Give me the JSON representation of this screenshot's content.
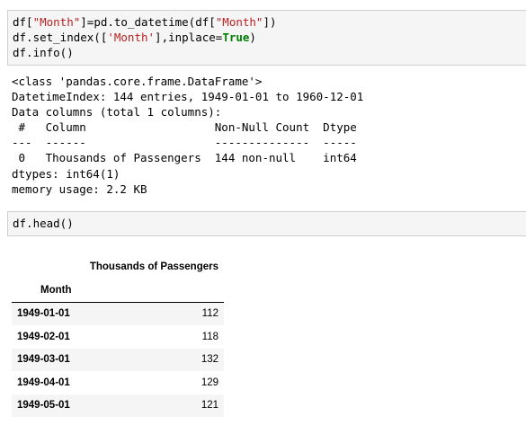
{
  "cell1": {
    "lines": [
      [
        {
          "t": "df[",
          "c": "n"
        },
        {
          "t": "\"Month\"",
          "c": "str"
        },
        {
          "t": "]=pd.to_datetime(df[",
          "c": "n"
        },
        {
          "t": "\"Month\"",
          "c": "str"
        },
        {
          "t": "])",
          "c": "n"
        }
      ],
      [
        {
          "t": "df.set_index([",
          "c": "n"
        },
        {
          "t": "'Month'",
          "c": "str"
        },
        {
          "t": "],inplace=",
          "c": "n"
        },
        {
          "t": "True",
          "c": "kw"
        },
        {
          "t": ")",
          "c": "n"
        }
      ],
      [
        {
          "t": "df.info()",
          "c": "n"
        }
      ]
    ]
  },
  "output1": {
    "lines": [
      "<class 'pandas.core.frame.DataFrame'>",
      "DatetimeIndex: 144 entries, 1949-01-01 to 1960-12-01",
      "Data columns (total 1 columns):",
      " #   Column                   Non-Null Count  Dtype",
      "---  ------                   --------------  -----",
      " 0   Thousands of Passengers  144 non-null    int64",
      "dtypes: int64(1)",
      "memory usage: 2.2 KB"
    ]
  },
  "cell2": {
    "lines": [
      [
        {
          "t": "df.head()",
          "c": "n"
        }
      ]
    ]
  },
  "dataframe": {
    "column_header": "Thousands of Passengers",
    "index_name": "Month",
    "rows": [
      {
        "index": "1949-01-01",
        "value": "112"
      },
      {
        "index": "1949-02-01",
        "value": "118"
      },
      {
        "index": "1949-03-01",
        "value": "132"
      },
      {
        "index": "1949-04-01",
        "value": "129"
      },
      {
        "index": "1949-05-01",
        "value": "121"
      }
    ]
  }
}
